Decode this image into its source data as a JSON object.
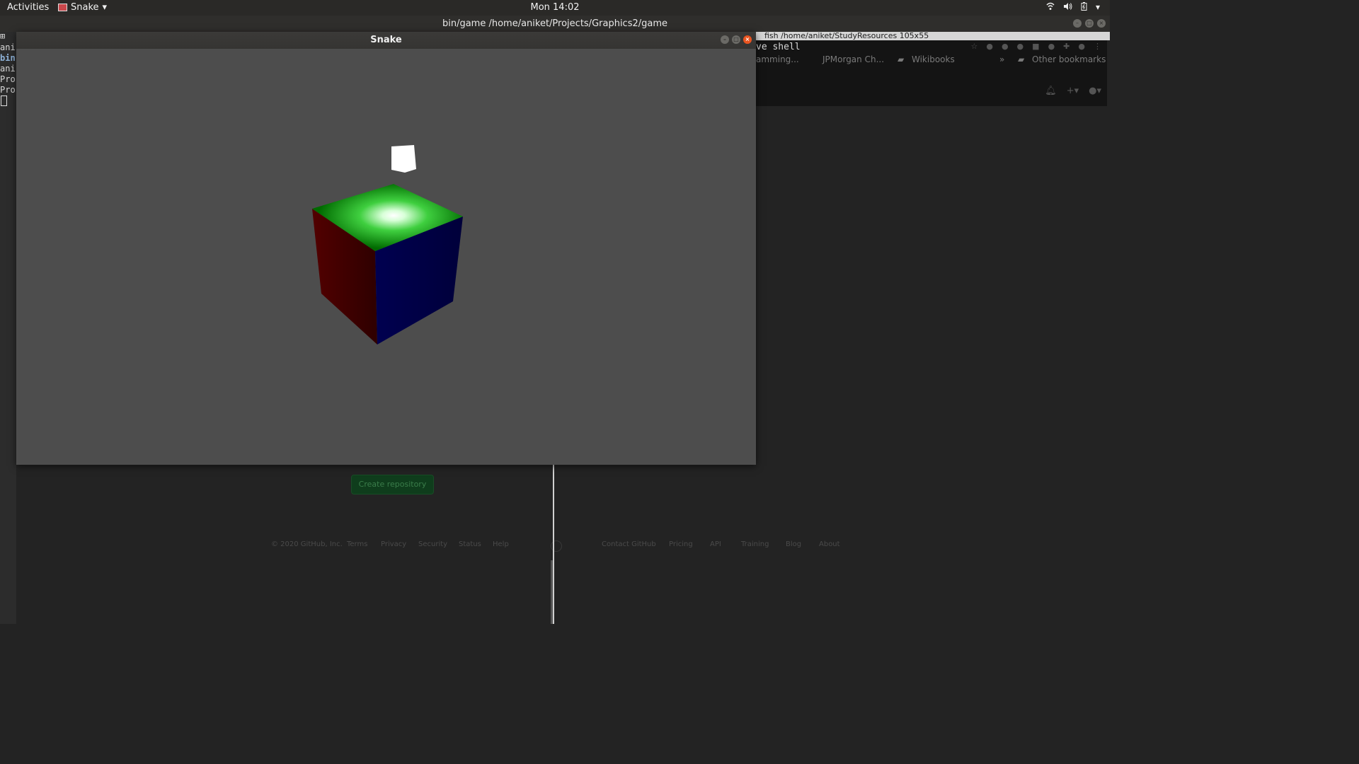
{
  "topbar": {
    "activities": "Activities",
    "app_name": "Snake",
    "clock": "Mon 14:02"
  },
  "terminal": {
    "title": "bin/game  /home/aniket/Projects/Graphics2/game",
    "lines": [
      "ani",
      "bin",
      "ani",
      "Pro",
      "Pro"
    ]
  },
  "fish": {
    "title": "fish  /home/aniket/StudyResources 105x55",
    "shell_text": "ve shell"
  },
  "browser": {
    "bookmarks": [
      "amming...",
      "JPMorgan Ch...",
      "Wikibooks",
      "»",
      "Other bookmarks"
    ]
  },
  "github": {
    "create_repo": "Create repository",
    "footer_left": [
      "© 2020 GitHub, Inc.",
      "Terms",
      "Privacy",
      "Security",
      "Status",
      "Help"
    ],
    "footer_right": [
      "Contact GitHub",
      "Pricing",
      "API",
      "Training",
      "Blog",
      "About"
    ]
  },
  "snake_window": {
    "title": "Snake"
  },
  "colors": {
    "cube_top": "#00b000",
    "cube_left": "#3a0000",
    "cube_right": "#000048",
    "light_cube": "#ffffff",
    "viewport_bg": "#4d4d4d",
    "close_button": "#e95420"
  }
}
